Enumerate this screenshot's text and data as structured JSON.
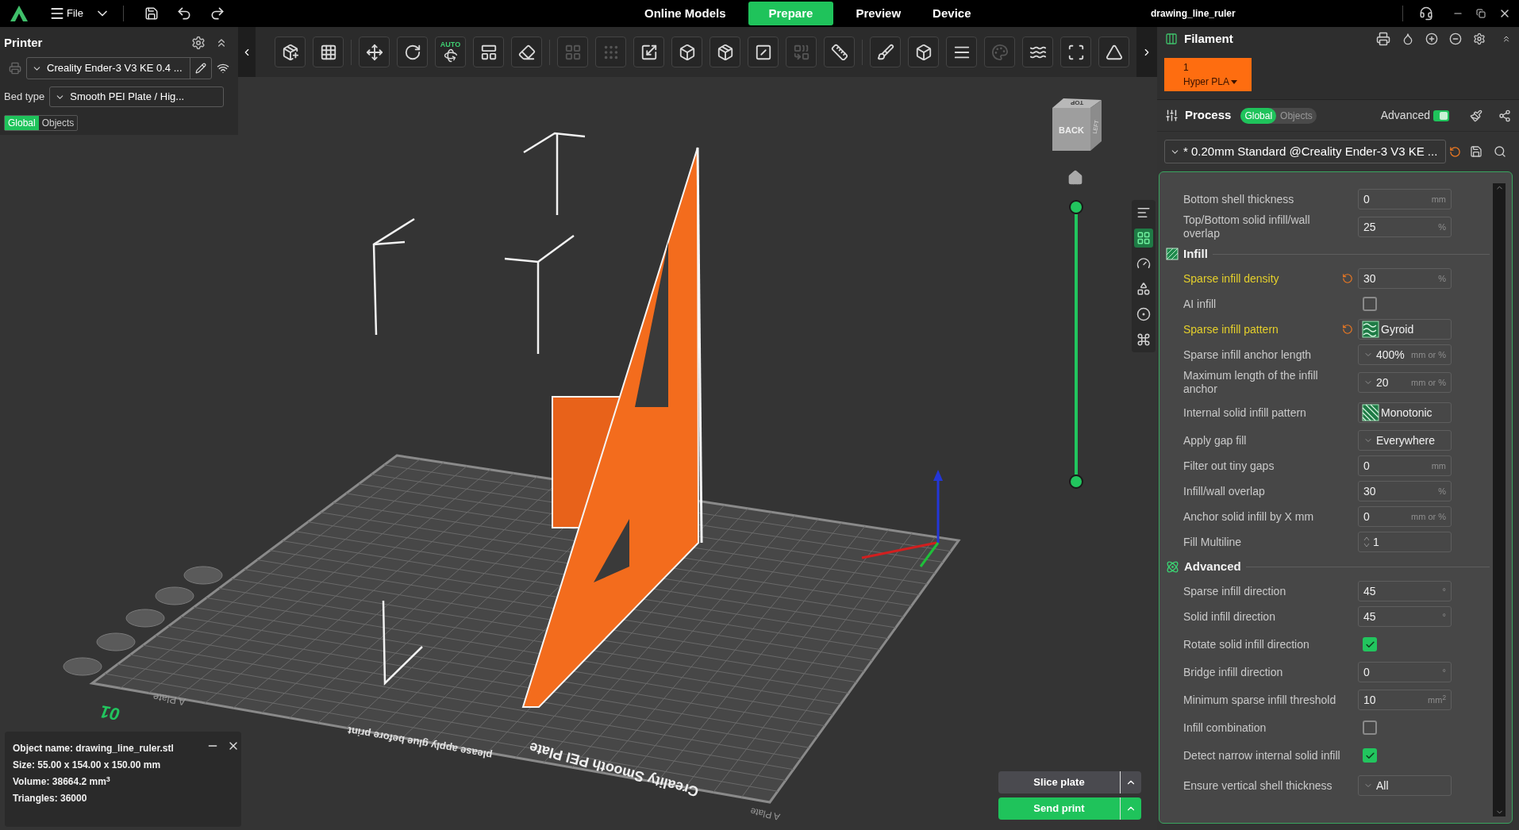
{
  "topbar": {
    "menu_label": "File",
    "tabs": [
      {
        "label": "Online Models",
        "selected": false
      },
      {
        "label": "Prepare",
        "selected": true
      },
      {
        "label": "Preview",
        "selected": false
      },
      {
        "label": "Device",
        "selected": false
      }
    ],
    "title": "drawing_line_ruler"
  },
  "printer_panel": {
    "title": "Printer",
    "printer": "Creality Ender-3 V3 KE 0.4 ...",
    "bed_type_label": "Bed type",
    "bed_type": "Smooth PEI Plate / Hig...",
    "tabs": [
      {
        "label": "Global",
        "selected": true
      },
      {
        "label": "Objects",
        "selected": false
      }
    ]
  },
  "toolbar": [
    {
      "kind": "tool",
      "disabled": false
    },
    {
      "kind": "tool",
      "disabled": false
    },
    {
      "kind": "separator"
    },
    {
      "kind": "tool",
      "disabled": false
    },
    {
      "kind": "tool",
      "disabled": false
    },
    {
      "kind": "tool",
      "disabled": false,
      "badge": "AUTO"
    },
    {
      "kind": "tool",
      "disabled": false
    },
    {
      "kind": "tool",
      "disabled": false
    },
    {
      "kind": "separator"
    },
    {
      "kind": "tool",
      "disabled": true
    },
    {
      "kind": "tool",
      "disabled": true
    },
    {
      "kind": "tool",
      "disabled": false
    },
    {
      "kind": "tool",
      "disabled": false
    },
    {
      "kind": "tool",
      "disabled": false
    },
    {
      "kind": "tool",
      "disabled": false
    },
    {
      "kind": "tool",
      "disabled": true
    },
    {
      "kind": "tool",
      "disabled": false
    },
    {
      "kind": "separator"
    },
    {
      "kind": "tool",
      "disabled": false
    },
    {
      "kind": "tool",
      "disabled": false
    },
    {
      "kind": "tool",
      "disabled": false
    },
    {
      "kind": "tool",
      "disabled": true
    },
    {
      "kind": "tool",
      "disabled": false
    },
    {
      "kind": "tool",
      "disabled": false
    },
    {
      "kind": "tool",
      "disabled": false
    }
  ],
  "viewport": {
    "nav_cube": {
      "front": "BACK",
      "top": "TOP",
      "side": "LEFT"
    },
    "plate": {
      "number": "01",
      "name_left": "A Plate",
      "name_right": "A Plate",
      "brand": "Creality Smooth PEI Plate",
      "note": "please apply glue before print"
    }
  },
  "side_tools": [
    {
      "selected": false
    },
    {
      "selected": true
    },
    {
      "selected": false
    },
    {
      "selected": false
    },
    {
      "selected": false
    },
    {
      "selected": false
    }
  ],
  "object_info": {
    "lines": [
      "Object name: drawing_line_ruler.stl",
      "Size: 55.00 x 154.00 x 150.00 mm",
      "Volume: 38664.2 mm$^{3}$",
      "Triangles: 36000"
    ]
  },
  "actions": [
    {
      "label": "Slice plate",
      "kind": "secondary"
    },
    {
      "label": "Send print",
      "kind": "primary"
    }
  ],
  "filament": {
    "title": "Filament",
    "slots": [
      {
        "number": "1",
        "name": "Hyper PLA",
        "color": "#fe6d10"
      }
    ]
  },
  "process": {
    "title": "Process",
    "tabs": [
      {
        "label": "Global",
        "selected": true
      },
      {
        "label": "Objects",
        "selected": false
      }
    ],
    "advanced_label": "Advanced",
    "advanced_on": true,
    "preset": "* 0.20mm Standard @Creality Ender-3 V3 KE ...",
    "preset_modified": true
  },
  "settings": [
    {
      "kind": "input",
      "label": "Bottom shell thickness",
      "value": "0",
      "unit": "mm",
      "modified": false
    },
    {
      "kind": "input",
      "label": "Top/Bottom solid infill/wall overlap",
      "value": "25",
      "unit": "%",
      "modified": false
    },
    {
      "kind": "section",
      "label": "Infill"
    },
    {
      "kind": "input",
      "label": "Sparse infill density",
      "value": "30",
      "unit": "%",
      "modified": true
    },
    {
      "kind": "checkbox",
      "label": "AI infill",
      "checked": false,
      "modified": false
    },
    {
      "kind": "pattern",
      "label": "Sparse infill pattern",
      "value": "Gyroid",
      "modified": true
    },
    {
      "kind": "combo",
      "label": "Sparse infill anchor length",
      "value": "400%",
      "unit": "mm or %",
      "modified": false
    },
    {
      "kind": "combo",
      "label": "Maximum length of the infill anchor",
      "value": "20",
      "unit": "mm or %",
      "modified": false
    },
    {
      "kind": "pattern",
      "label": "Internal solid infill pattern",
      "value": "Monotonic",
      "modified": false
    },
    {
      "kind": "dropdown",
      "label": "Apply gap fill",
      "value": "Everywhere",
      "modified": false
    },
    {
      "kind": "input",
      "label": "Filter out tiny gaps",
      "value": "0",
      "unit": "mm",
      "modified": false
    },
    {
      "kind": "input",
      "label": "Infill/wall overlap",
      "value": "30",
      "unit": "%",
      "modified": false
    },
    {
      "kind": "input",
      "label": "Anchor solid infill by X mm",
      "value": "0",
      "unit": "mm or %",
      "modified": false
    },
    {
      "kind": "spin",
      "label": "Fill Multiline",
      "value": "1",
      "modified": false
    },
    {
      "kind": "section",
      "label": "Advanced"
    },
    {
      "kind": "input",
      "label": "Sparse infill direction",
      "value": "45",
      "unit": "°",
      "modified": false
    },
    {
      "kind": "input",
      "label": "Solid infill direction",
      "value": "45",
      "unit": "°",
      "modified": false
    },
    {
      "kind": "checkbox",
      "label": "Rotate solid infill direction",
      "checked": true,
      "modified": false
    },
    {
      "kind": "input",
      "label": "Bridge infill direction",
      "value": "0",
      "unit": "°",
      "modified": false
    },
    {
      "kind": "input",
      "label": "Minimum sparse infill threshold",
      "value": "10",
      "unit": "mm$^{2}$",
      "modified": false
    },
    {
      "kind": "checkbox",
      "label": "Infill combination",
      "checked": false,
      "modified": false
    },
    {
      "kind": "checkbox",
      "label": "Detect narrow internal solid infill",
      "checked": true,
      "modified": false
    },
    {
      "kind": "dropdown",
      "label": "Ensure vertical shell thickness",
      "value": "All",
      "modified": false
    }
  ]
}
